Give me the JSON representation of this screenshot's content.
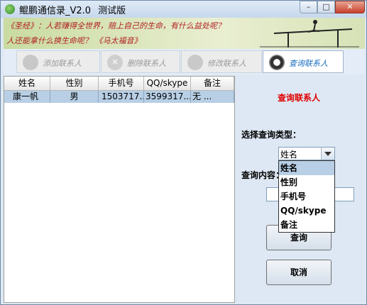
{
  "window": {
    "title": "鲲鹏通信录_V2.0",
    "subtitle": "测试版",
    "controls": {
      "minimize": "–",
      "maximize": "□",
      "close": "✕"
    }
  },
  "banner": {
    "line1": "《圣经》：人若赚得全世界，赔上自己的生命，有什么益处呢？",
    "line2": "人还能拿什么换生命呢？  《马太福音》"
  },
  "toolbar": {
    "add_label": "添加联系人",
    "delete_label": "删除联系人",
    "modify_label": "修改联系人",
    "query_label": "查询联系人"
  },
  "table": {
    "columns": [
      "姓名",
      "性别",
      "手机号",
      "QQ/skype",
      "备注"
    ],
    "rows": [
      [
        "康一帆",
        "男",
        "1503717...",
        "3599317...",
        "无     ..."
      ]
    ]
  },
  "query_panel": {
    "title": "查询联系人",
    "type_label": "选择查询类型：",
    "selected_type": "姓名",
    "type_options": [
      "姓名",
      "性别",
      "手机号",
      "QQ/skype",
      "备注"
    ],
    "content_label": "查询内容：",
    "content_value": "",
    "query_button": "查询",
    "cancel_button": "取消"
  },
  "colors": {
    "selection": "#b8cfe5",
    "panel_title": "#e00000",
    "banner_text": "#b02020"
  }
}
